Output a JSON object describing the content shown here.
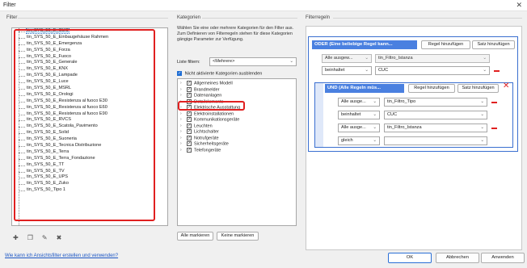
{
  "window": {
    "title": "Filter",
    "close_glyph": "✕"
  },
  "filter": {
    "label": "Filter",
    "items": [
      "tin_SYS_50_E_CUC",
      "tin_SYS_50_E_Einbaugehäuse Rahmen",
      "tin_SYS_50_E_Emergenza",
      "tin_SYS_50_E_Forza",
      "tin_SYS_50_E_Fuoco",
      "tin_SYS_50_E_Generale",
      "tin_SYS_50_E_KNX",
      "tin_SYS_50_E_Lampade",
      "tin_SYS_50_E_Luce",
      "tin_SYS_50_E_MSRL",
      "tin_SYS_50_E_Orologi",
      "tin_SYS_50_E_Resistenza al fuoco E30",
      "tin_SYS_50_E_Resistenza al fuoco E60",
      "tin_SYS_50_E_Resistenza al fuoco E90",
      "tin_SYS_50_E_RVCS",
      "tin_SYS_50_E_Scatola_Pavimento",
      "tin_SYS_50_E_Solid",
      "tin_SYS_50_E_Suoneria",
      "tin_SYS_50_E_Tecnica Distribuzione",
      "tin_SYS_50_E_Terra",
      "tin_SYS_50_E_Terra_Fondazione",
      "tin_SYS_50_E_TT",
      "tin_SYS_50_E_TV",
      "tin_SYS_50_E_UPS",
      "tin_SYS_50_E_Zuko",
      "tin_SYS_50_Tipo 1"
    ],
    "selected_index": 0,
    "toolbar_icons": [
      "new-filter-icon",
      "duplicate-filter-icon",
      "rename-filter-icon",
      "delete-filter-icon"
    ],
    "help_link": "Wie kann ich Ansichtsfilter erstellen und verwenden?"
  },
  "categories": {
    "label": "Kategorien",
    "description": "Wählen Sie eine oder mehrere Kategorien für den Filter aus. Zum Definieren von Filterregeln stehen für diese Kategorien gängige Parameter zur Verfügung.",
    "list_filter_label": "Liste filtern:",
    "list_filter_value": "<Mehrere>",
    "hide_unchecked_label": "Nicht aktivierte Kategorien ausblenden",
    "hide_unchecked_checked": true,
    "items": [
      {
        "label": "Allgemeines Modell",
        "checked": true,
        "expandable": true
      },
      {
        "label": "Brandmelder",
        "checked": true,
        "expandable": true
      },
      {
        "label": "Datenanlagen",
        "checked": true,
        "expandable": true
      },
      {
        "label": "Detailelemente",
        "checked": true,
        "expandable": true
      },
      {
        "label": "Elektrische Ausstattung",
        "checked": true,
        "expandable": true
      },
      {
        "label": "Elektroinstallationen",
        "checked": true,
        "expandable": true
      },
      {
        "label": "Kommunikationsgeräte",
        "checked": true,
        "expandable": true
      },
      {
        "label": "Leuchten",
        "checked": true,
        "expandable": true
      },
      {
        "label": "Lichtschalter",
        "checked": true,
        "expandable": true
      },
      {
        "label": "Notrufgeräte",
        "checked": true,
        "expandable": true
      },
      {
        "label": "Sicherheitsgeräte",
        "checked": true,
        "expandable": true
      },
      {
        "label": "Telefongeräte",
        "checked": true,
        "expandable": true
      }
    ],
    "select_all_label": "Alle markieren",
    "select_none_label": "Keine markieren"
  },
  "rules": {
    "label": "Filterregeln",
    "outer_group": {
      "header": "ODER (Eine beliebige Regel kann...",
      "add_rule_label": "Regel hinzufügen",
      "add_set_label": "Satz hinzufügen",
      "rule": {
        "param_scope": "Alle ausgew...",
        "param": "tin_Filtro_Istanza",
        "operator": "beinhaltet",
        "value": "CUC"
      }
    },
    "inner_group": {
      "header": "UND (Alle Regeln müs...",
      "add_rule_label": "Regel hinzufügen",
      "add_set_label": "Satz hinzufügen",
      "rules": [
        {
          "param_scope": "Alle ausge...",
          "param": "tin_Filtro_Tipo",
          "operator": "beinhaltet",
          "value": "CUC"
        },
        {
          "param_scope": "Alle ausge...",
          "param": "tin_Filtro_Istanza",
          "operator": "gleich",
          "value": ""
        }
      ]
    }
  },
  "footer": {
    "ok_label": "OK",
    "cancel_label": "Abbrechen",
    "apply_label": "Anwenden"
  },
  "colors": {
    "accent": "#3a6fd0",
    "highlight": "#e02020",
    "selection": "#cce4f7"
  }
}
